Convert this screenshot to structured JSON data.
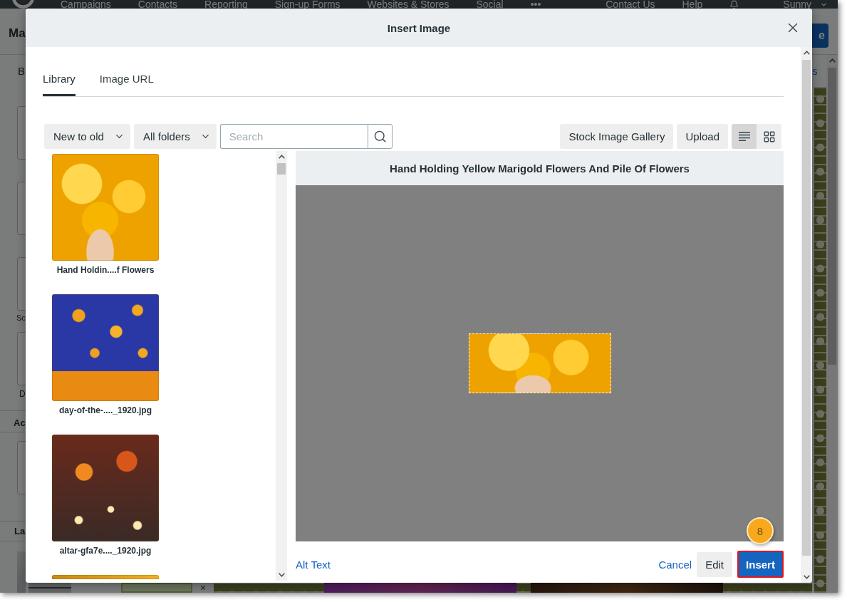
{
  "background_page": {
    "nav_items": [
      {
        "label": "Campaigns"
      },
      {
        "label": "Contacts"
      },
      {
        "label": "Reporting"
      },
      {
        "label": "Sign-up Forms"
      },
      {
        "label": "Websites & Stores"
      },
      {
        "label": "Social"
      }
    ],
    "nav_more": "•••",
    "nav_links": [
      "Contact Us",
      "Help"
    ],
    "user_name": "Sunny",
    "page_title": "Ma",
    "header_button": "e",
    "editor_tab": "B",
    "tile_captions": [
      "Sc",
      "D"
    ],
    "section_headings": [
      "Ac",
      "La"
    ],
    "side_link": "s",
    "close_mark": "×"
  },
  "dialog": {
    "title": "Insert Image",
    "tabs": [
      {
        "label": "Library",
        "selected": true
      },
      {
        "label": "Image URL",
        "selected": false
      }
    ],
    "toolbar": {
      "sort": "New to old",
      "folder": "All folders",
      "search": {
        "placeholder": "Search"
      },
      "buttons": [
        "Stock Image Gallery",
        "Upload"
      ],
      "views": [
        {
          "kind": "list",
          "selected": true
        },
        {
          "kind": "grid",
          "selected": false
        }
      ]
    },
    "images": [
      {
        "caption": "Hand Holdin....f Flowers",
        "cut_off": false
      },
      {
        "caption": "day-of-the-...._1920.jpg",
        "cut_off": false
      },
      {
        "caption": "altar-gfa7e...._1920.jpg",
        "cut_off": false
      },
      {
        "cut_off": true
      }
    ],
    "preview": {
      "title": "Hand Holding Yellow Marigold Flowers And Pile Of Flowers"
    },
    "footer": {
      "alt_text": "Alt Text",
      "cancel": "Cancel",
      "edit": "Edit",
      "insert": {
        "label": "Insert",
        "highlighted": true
      }
    }
  },
  "annotation": {
    "step": "8"
  }
}
